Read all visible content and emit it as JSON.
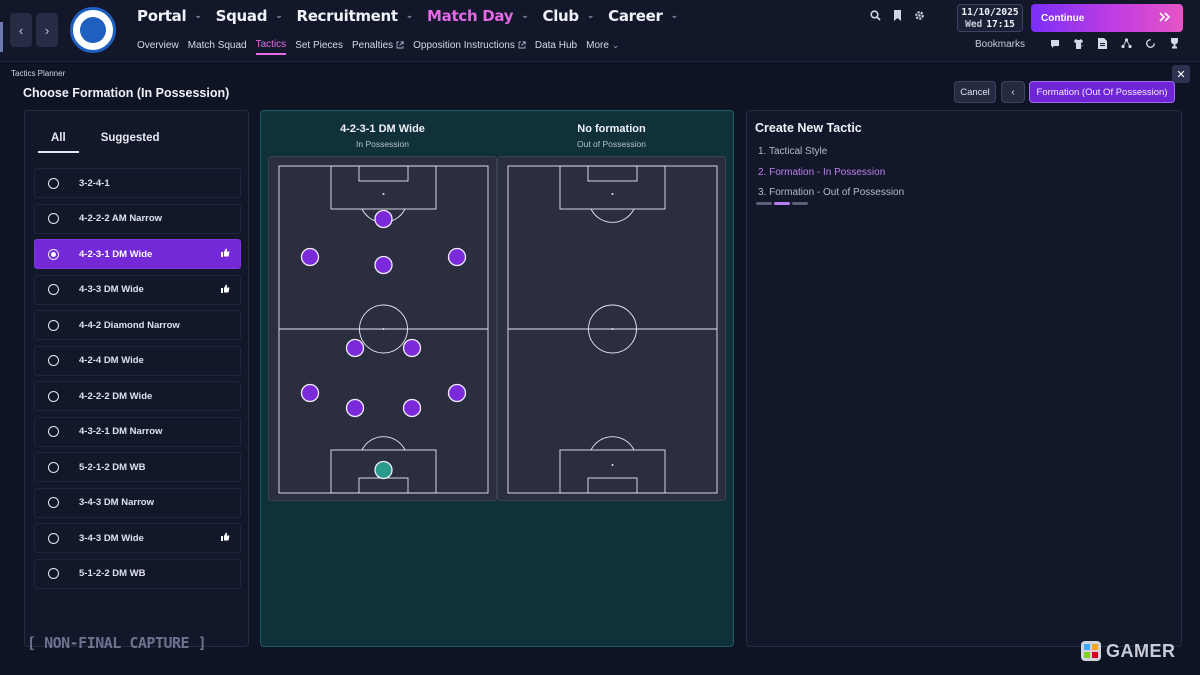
{
  "nav": {
    "main": [
      {
        "label": "Portal",
        "active": false
      },
      {
        "label": "Squad",
        "active": false
      },
      {
        "label": "Recruitment",
        "active": false
      },
      {
        "label": "Match Day",
        "active": true
      },
      {
        "label": "Club",
        "active": false
      },
      {
        "label": "Career",
        "active": false
      }
    ],
    "sub": [
      {
        "label": "Overview"
      },
      {
        "label": "Match Squad"
      },
      {
        "label": "Tactics",
        "active": true
      },
      {
        "label": "Set Pieces"
      },
      {
        "label": "Penalties",
        "external": true
      },
      {
        "label": "Opposition Instructions",
        "external": true
      },
      {
        "label": "Data Hub"
      },
      {
        "label": "More"
      }
    ]
  },
  "header": {
    "date": "11/10/2025",
    "weekday": "Wed",
    "time": "17:15",
    "continue_label": "Continue",
    "bookmarks_label": "Bookmarks"
  },
  "page": {
    "breadcrumb": "Tactics Planner",
    "title": "Choose Formation (In Possession)",
    "cancel_label": "Cancel",
    "next_label": "Formation (Out Of Possession)"
  },
  "formation_list": {
    "tabs": [
      {
        "label": "All",
        "active": true
      },
      {
        "label": "Suggested",
        "active": false
      }
    ],
    "items": [
      {
        "label": "3-2-4-1",
        "selected": false,
        "recommended": false
      },
      {
        "label": "4-2-2-2 AM Narrow",
        "selected": false,
        "recommended": false
      },
      {
        "label": "4-2-3-1 DM Wide",
        "selected": true,
        "recommended": true
      },
      {
        "label": "4-3-3 DM Wide",
        "selected": false,
        "recommended": true
      },
      {
        "label": "4-4-2 Diamond Narrow",
        "selected": false,
        "recommended": false
      },
      {
        "label": "4-2-4 DM Wide",
        "selected": false,
        "recommended": false
      },
      {
        "label": "4-2-2-2 DM Wide",
        "selected": false,
        "recommended": false
      },
      {
        "label": "4-3-2-1 DM Narrow",
        "selected": false,
        "recommended": false
      },
      {
        "label": "5-2-1-2 DM WB",
        "selected": false,
        "recommended": false
      },
      {
        "label": "3-4-3 DM Narrow",
        "selected": false,
        "recommended": false
      },
      {
        "label": "3-4-3 DM Wide",
        "selected": false,
        "recommended": true
      },
      {
        "label": "5-1-2-2 DM WB",
        "selected": false,
        "recommended": false
      }
    ]
  },
  "preview": {
    "in_possession": {
      "name": "4-2-3-1 DM Wide",
      "phase": "In Possession"
    },
    "out_of_possession": {
      "name": "No formation",
      "phase": "Out of Possession"
    }
  },
  "create_tactic": {
    "title": "Create New Tactic",
    "steps": [
      {
        "label": "1. Tactical Style",
        "current": false
      },
      {
        "label": "2. Formation - In Possession",
        "current": true
      },
      {
        "label": "3. Formation - Out of Possession",
        "current": false
      }
    ],
    "progress_step": 2,
    "progress_total": 3
  },
  "overlay": {
    "capture_label": "NON-FINAL CAPTURE",
    "watermark": "GAMER"
  },
  "colors": {
    "accent": "#7329d6",
    "active_nav": "#e46ae8",
    "player": "#7a2ad8",
    "goalkeeper": "#2a9a8c",
    "pitch": "#2a2e3f"
  },
  "icons": [
    "back-arrow-icon",
    "forward-arrow-icon",
    "search-icon",
    "bookmark-icon",
    "gear-icon",
    "double-chevron-icon",
    "chat-icon",
    "shirt-icon",
    "document-icon",
    "tactics-icon",
    "refresh-icon",
    "trophy-icon",
    "close-icon",
    "thumbs-up-icon"
  ]
}
